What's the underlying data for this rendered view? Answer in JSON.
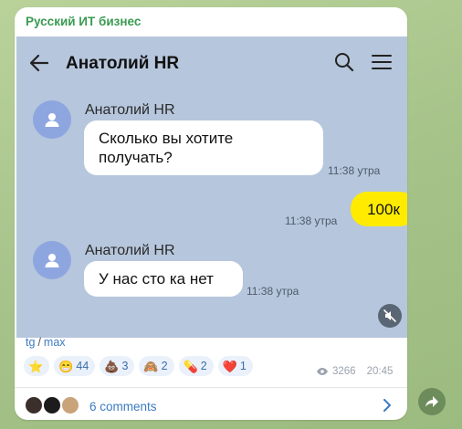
{
  "post": {
    "channel_name": "Русский ИТ бизнес"
  },
  "chat": {
    "title": "Анатолий HR",
    "messages": [
      {
        "sender": "Анатолий HR",
        "text": "Сколько вы хотите получать?",
        "time": "11:38 утра"
      },
      {
        "text": "100к",
        "time": "11:38 утра"
      },
      {
        "sender": "Анатолий HR",
        "text": "У нас сто ка нет",
        "time": "11:38 утра"
      }
    ]
  },
  "tags": {
    "first": "tg",
    "separator": "/",
    "second": "max"
  },
  "reactions": [
    {
      "emoji": "⭐",
      "count": ""
    },
    {
      "emoji": "😁",
      "count": "44"
    },
    {
      "emoji": "💩",
      "count": "3"
    },
    {
      "emoji": "🙈",
      "count": "2"
    },
    {
      "emoji": "💊",
      "count": "2"
    },
    {
      "emoji": "❤️",
      "count": "1"
    }
  ],
  "meta": {
    "views": "3266",
    "time": "20:45"
  },
  "comments": {
    "label": "6 comments"
  },
  "colors": {
    "channel_name": "#3a9b52",
    "link": "#3b7bc1",
    "outgoing_bubble": "#ffeb00",
    "avatar": "#8ea6e0",
    "chat_background": "#b6c6dc"
  }
}
